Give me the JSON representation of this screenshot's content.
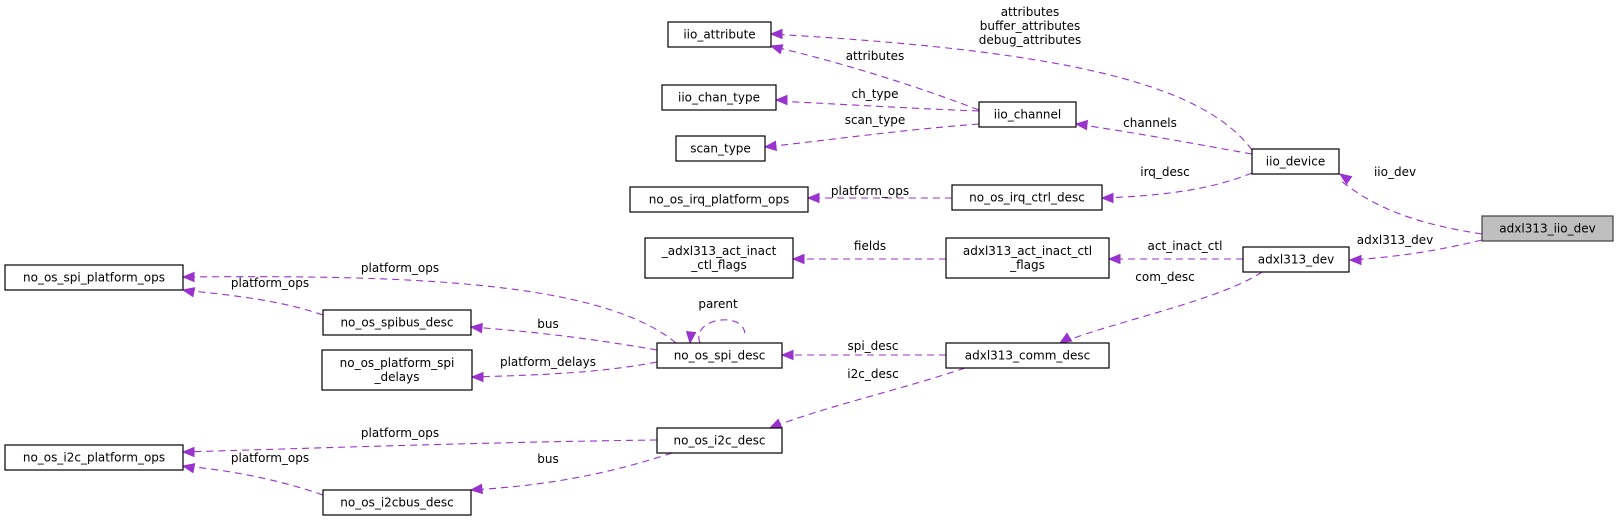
{
  "graph": {
    "type": "collaboration-diagram",
    "edge_color": "#9a32cd",
    "root_fill": "#bfbfbf",
    "nodes": [
      {
        "id": "adxl313_iio_dev",
        "lines": [
          "adxl313_iio_dev"
        ],
        "root": true
      },
      {
        "id": "iio_device",
        "lines": [
          "iio_device"
        ]
      },
      {
        "id": "adxl313_dev",
        "lines": [
          "adxl313_dev"
        ]
      },
      {
        "id": "iio_attribute",
        "lines": [
          "iio_attribute"
        ]
      },
      {
        "id": "iio_channel",
        "lines": [
          "iio_channel"
        ]
      },
      {
        "id": "iio_chan_type",
        "lines": [
          "iio_chan_type"
        ]
      },
      {
        "id": "scan_type",
        "lines": [
          "scan_type"
        ]
      },
      {
        "id": "no_os_irq_ctrl_desc",
        "lines": [
          "no_os_irq_ctrl_desc"
        ]
      },
      {
        "id": "no_os_irq_platform_ops",
        "lines": [
          "no_os_irq_platform_ops"
        ]
      },
      {
        "id": "adxl313_act_inact_ctl_flags",
        "lines": [
          "adxl313_act_inact_ctl",
          "_flags"
        ]
      },
      {
        "id": "_adxl313_act_inact_ctl_flags",
        "lines": [
          "_adxl313_act_inact",
          "_ctl_flags"
        ]
      },
      {
        "id": "adxl313_comm_desc",
        "lines": [
          "adxl313_comm_desc"
        ]
      },
      {
        "id": "no_os_spi_desc",
        "lines": [
          "no_os_spi_desc"
        ]
      },
      {
        "id": "no_os_spi_platform_ops",
        "lines": [
          "no_os_spi_platform_ops"
        ]
      },
      {
        "id": "no_os_spibus_desc",
        "lines": [
          "no_os_spibus_desc"
        ]
      },
      {
        "id": "no_os_platform_spi_delays",
        "lines": [
          "no_os_platform_spi",
          "_delays"
        ]
      },
      {
        "id": "no_os_i2c_desc",
        "lines": [
          "no_os_i2c_desc"
        ]
      },
      {
        "id": "no_os_i2c_platform_ops",
        "lines": [
          "no_os_i2c_platform_ops"
        ]
      },
      {
        "id": "no_os_i2cbus_desc",
        "lines": [
          "no_os_i2cbus_desc"
        ]
      }
    ],
    "edges": [
      {
        "from": "adxl313_iio_dev",
        "to": "iio_device",
        "label": [
          "iio_dev"
        ]
      },
      {
        "from": "adxl313_iio_dev",
        "to": "adxl313_dev",
        "label": [
          "adxl313_dev"
        ]
      },
      {
        "from": "iio_device",
        "to": "iio_attribute",
        "label": [
          "attributes",
          "buffer_attributes",
          "debug_attributes"
        ]
      },
      {
        "from": "iio_device",
        "to": "iio_channel",
        "label": [
          "channels"
        ]
      },
      {
        "from": "iio_device",
        "to": "no_os_irq_ctrl_desc",
        "label": [
          "irq_desc"
        ]
      },
      {
        "from": "iio_channel",
        "to": "iio_attribute",
        "label": [
          "attributes"
        ]
      },
      {
        "from": "iio_channel",
        "to": "iio_chan_type",
        "label": [
          "ch_type"
        ]
      },
      {
        "from": "iio_channel",
        "to": "scan_type",
        "label": [
          "scan_type"
        ]
      },
      {
        "from": "no_os_irq_ctrl_desc",
        "to": "no_os_irq_platform_ops",
        "label": [
          "platform_ops"
        ]
      },
      {
        "from": "adxl313_dev",
        "to": "adxl313_act_inact_ctl_flags",
        "label": [
          "act_inact_ctl"
        ]
      },
      {
        "from": "adxl313_dev",
        "to": "adxl313_comm_desc",
        "label": [
          "com_desc"
        ]
      },
      {
        "from": "adxl313_act_inact_ctl_flags",
        "to": "_adxl313_act_inact_ctl_flags",
        "label": [
          "fields"
        ]
      },
      {
        "from": "adxl313_comm_desc",
        "to": "no_os_spi_desc",
        "label": [
          "spi_desc"
        ]
      },
      {
        "from": "adxl313_comm_desc",
        "to": "no_os_i2c_desc",
        "label": [
          "i2c_desc"
        ]
      },
      {
        "from": "no_os_spi_desc",
        "to": "no_os_spi_platform_ops",
        "label": [
          "platform_ops"
        ]
      },
      {
        "from": "no_os_spi_desc",
        "to": "no_os_spibus_desc",
        "label": [
          "bus"
        ]
      },
      {
        "from": "no_os_spi_desc",
        "to": "no_os_platform_spi_delays",
        "label": [
          "platform_delays"
        ]
      },
      {
        "from": "no_os_spi_desc",
        "to": "no_os_spi_desc",
        "label": [
          "parent"
        ]
      },
      {
        "from": "no_os_spibus_desc",
        "to": "no_os_spi_platform_ops",
        "label": [
          "platform_ops"
        ]
      },
      {
        "from": "no_os_i2c_desc",
        "to": "no_os_i2c_platform_ops",
        "label": [
          "platform_ops"
        ]
      },
      {
        "from": "no_os_i2c_desc",
        "to": "no_os_i2cbus_desc",
        "label": [
          "bus"
        ]
      },
      {
        "from": "no_os_i2cbus_desc",
        "to": "no_os_i2c_platform_ops",
        "label": [
          "platform_ops"
        ]
      }
    ]
  }
}
